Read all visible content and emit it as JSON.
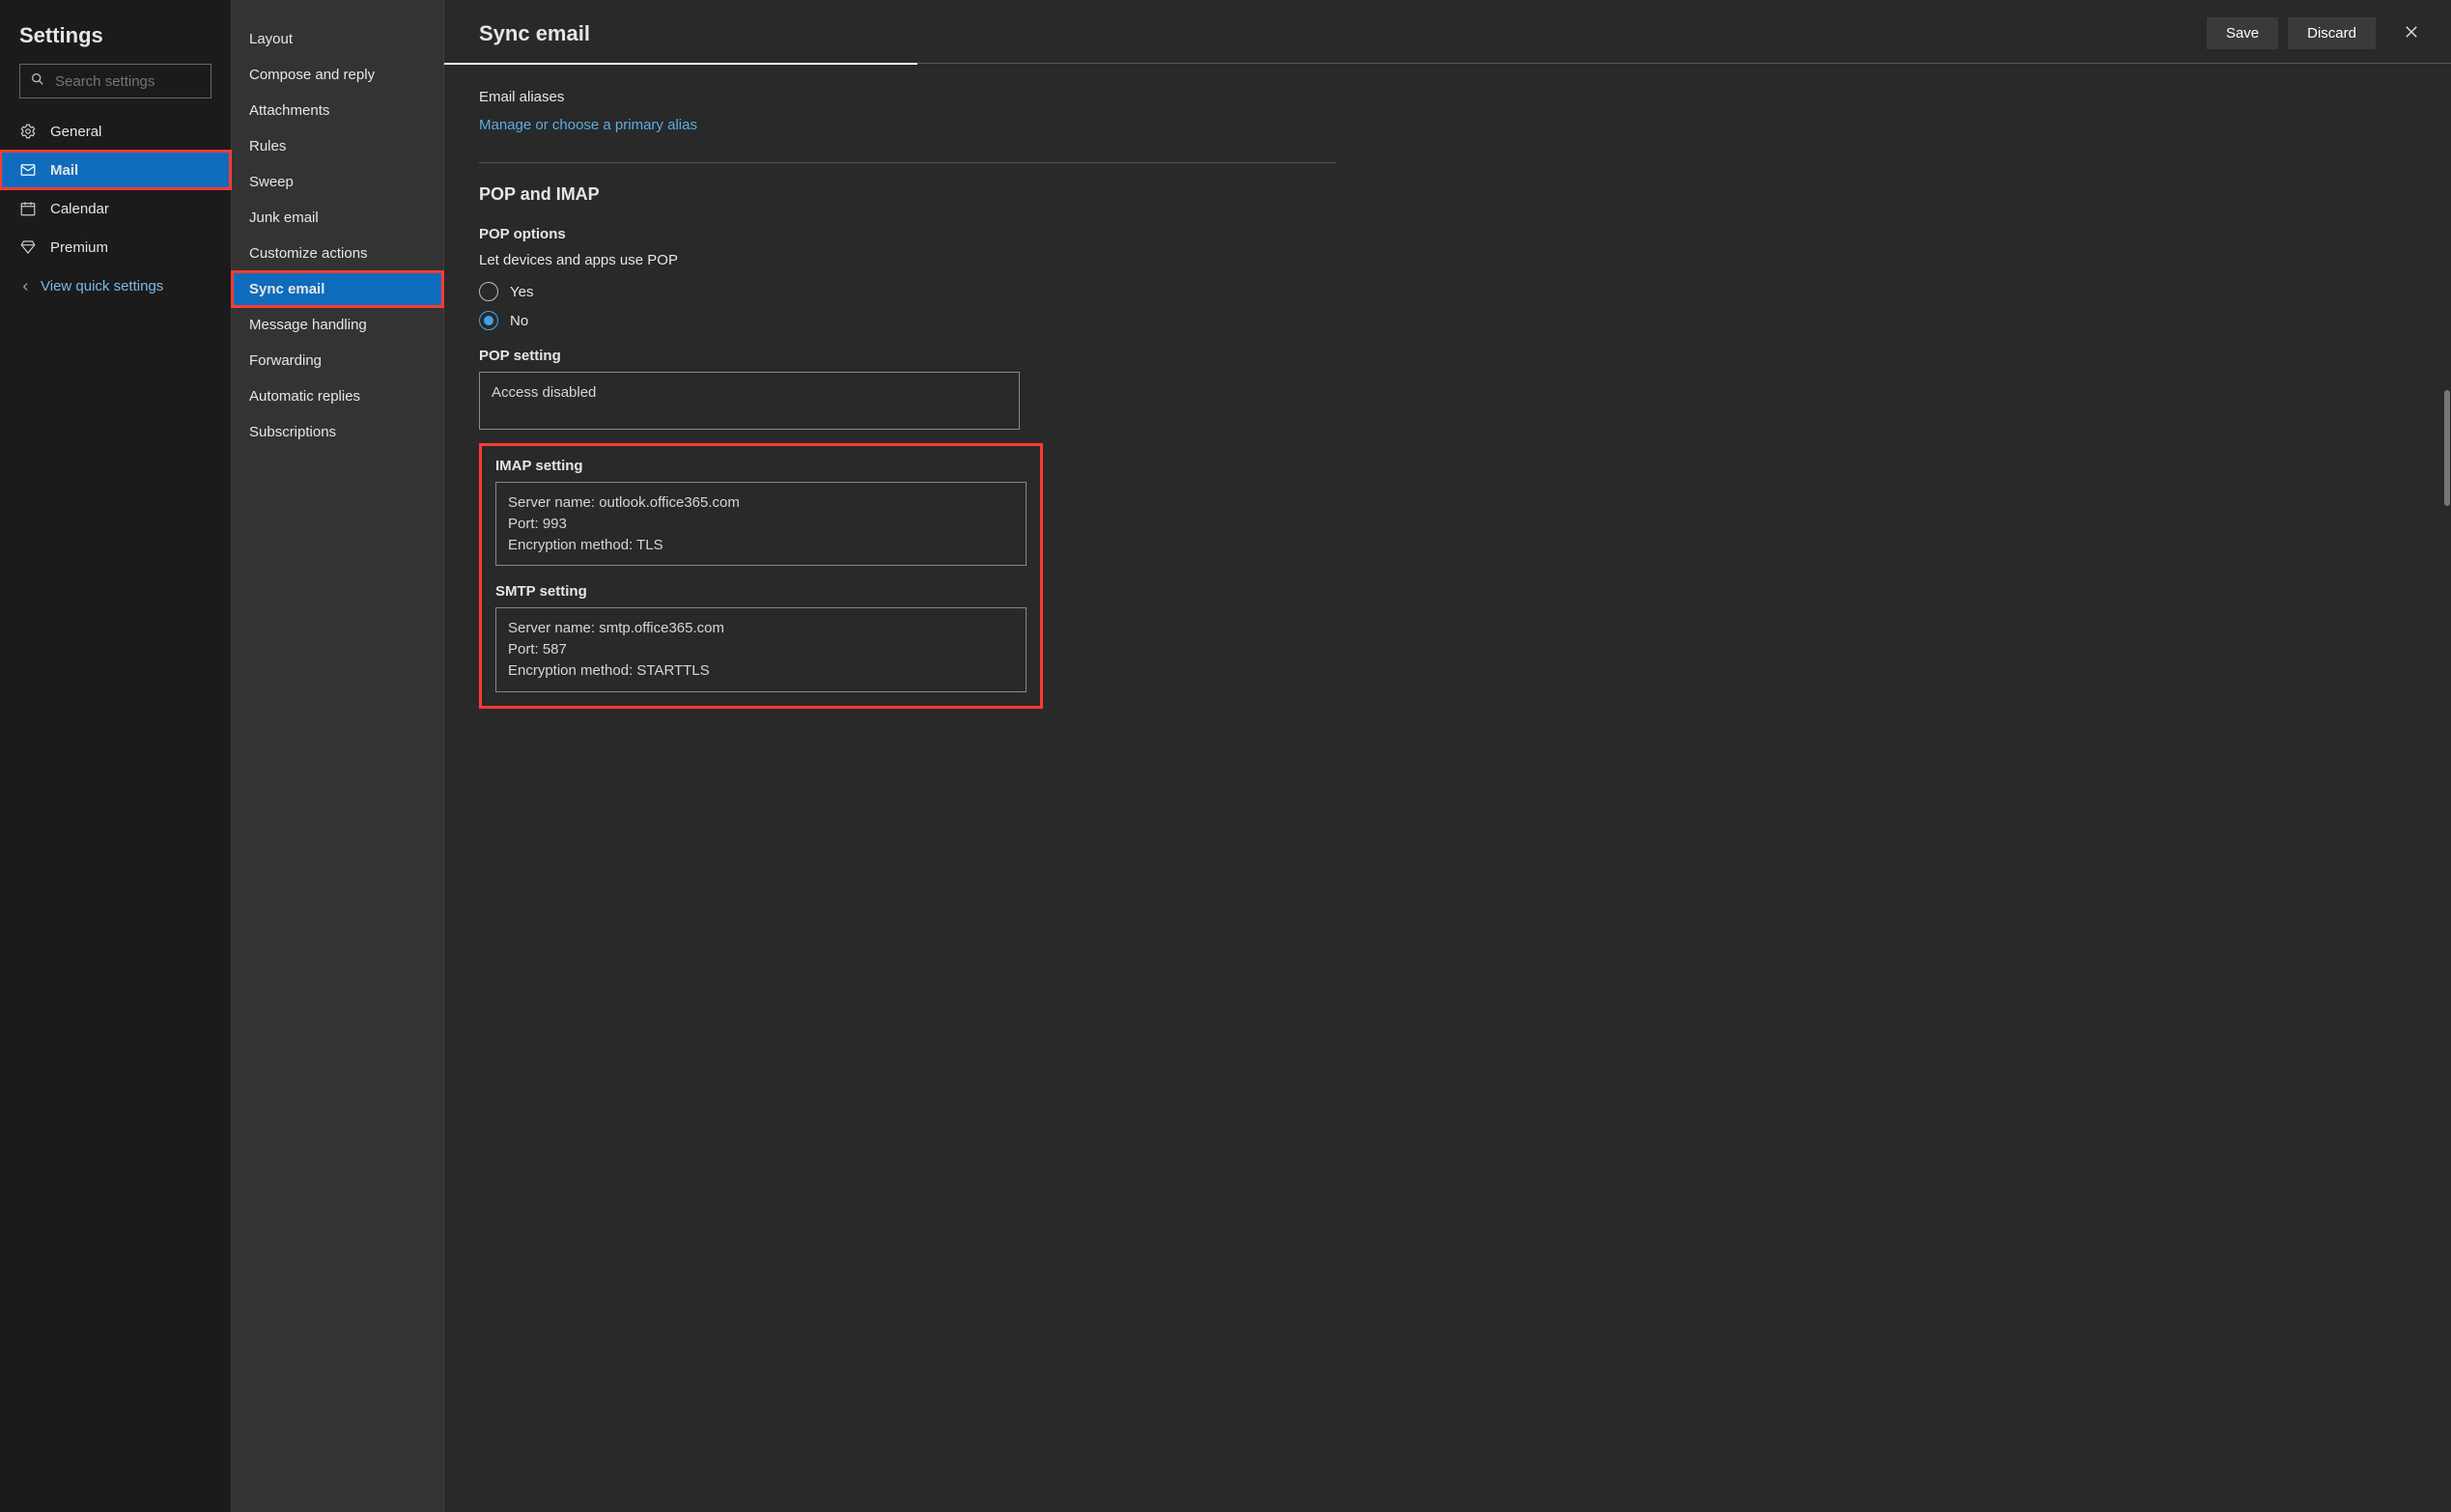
{
  "sidebar": {
    "title": "Settings",
    "search_placeholder": "Search settings",
    "items": [
      {
        "label": "General",
        "icon": "gear"
      },
      {
        "label": "Mail",
        "icon": "mail"
      },
      {
        "label": "Calendar",
        "icon": "calendar"
      },
      {
        "label": "Premium",
        "icon": "diamond"
      }
    ],
    "quick_link": "View quick settings"
  },
  "mid_nav": {
    "items": [
      "Layout",
      "Compose and reply",
      "Attachments",
      "Rules",
      "Sweep",
      "Junk email",
      "Customize actions",
      "Sync email",
      "Message handling",
      "Forwarding",
      "Automatic replies",
      "Subscriptions"
    ]
  },
  "header": {
    "title": "Sync email",
    "save": "Save",
    "discard": "Discard"
  },
  "aliases": {
    "label": "Email aliases",
    "link": "Manage or choose a primary alias"
  },
  "popimap": {
    "section_title": "POP and IMAP",
    "pop_options_label": "POP options",
    "pop_allow_label": "Let devices and apps use POP",
    "yes": "Yes",
    "no": "No",
    "pop_setting_label": "POP setting",
    "pop_setting_value": "Access disabled",
    "imap_setting_label": "IMAP setting",
    "imap_server": "Server name: outlook.office365.com",
    "imap_port": "Port: 993",
    "imap_enc": "Encryption method: TLS",
    "smtp_setting_label": "SMTP setting",
    "smtp_server": "Server name: smtp.office365.com",
    "smtp_port": "Port: 587",
    "smtp_enc": "Encryption method: STARTTLS"
  }
}
